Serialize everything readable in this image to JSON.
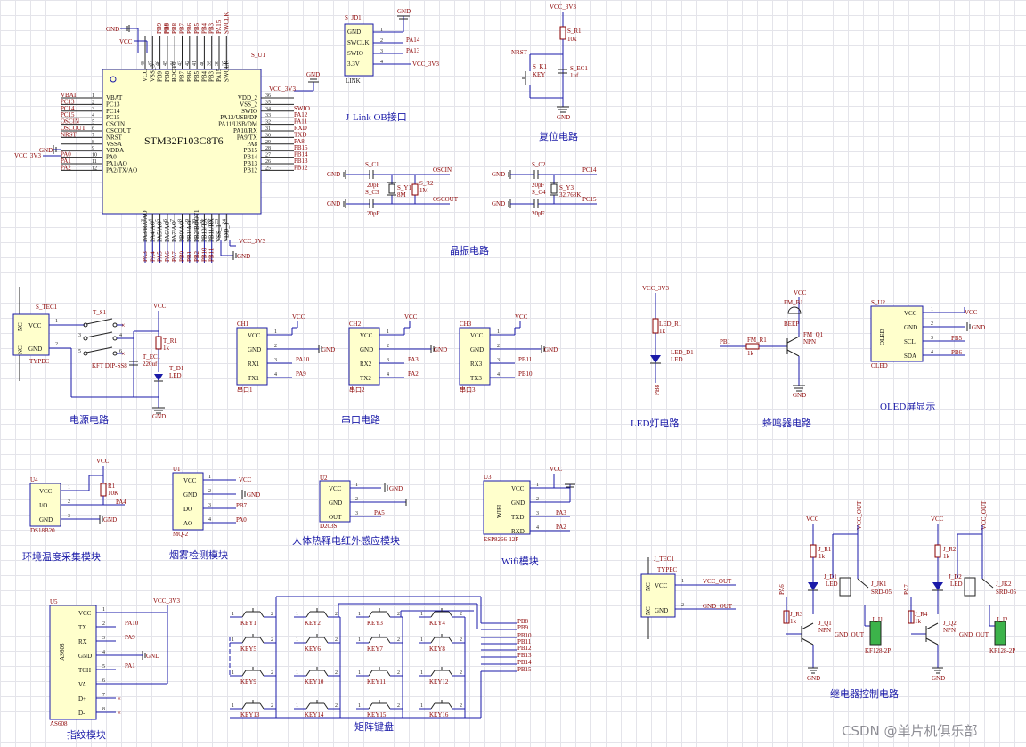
{
  "titles": {
    "jlink": "J-Link OB接口",
    "reset": "复位电路",
    "crystal": "晶振电路",
    "power": "电源电路",
    "serial": "串口电路",
    "led": "LED灯电路",
    "buzzer": "蜂鸣器电路",
    "oled": "OLED屏显示",
    "temp": "环境温度采集模块",
    "smoke": "烟雾检测模块",
    "pir": "人体热释电红外感应模块",
    "wifi": "Wifi模块",
    "finger": "指纹模块",
    "keypad": "矩阵键盘",
    "relay": "继电器控制电路"
  },
  "mcu": {
    "ref": "S_U1",
    "part": "STM32F103C8T6",
    "left_pins": [
      "VBAT",
      "PC13",
      "PC14",
      "PC15",
      "OSCIN",
      "OSCOUT",
      "NRST",
      "VSSA",
      "VDDA",
      "PA0",
      "PA1/AO",
      "PA2/TX/AO"
    ],
    "left_nums": [
      "1",
      "2",
      "3",
      "4",
      "5",
      "6",
      "7",
      "8",
      "9",
      "10",
      "11",
      "12"
    ],
    "left_nets": [
      "VBAT",
      "PC13",
      "PC14",
      "PC15",
      "OSCIN",
      "OSCOUT",
      "NRST",
      "GND",
      "VCC_3V3",
      "PA0",
      "PA1",
      "PA2"
    ],
    "right_pins": [
      "VDD_2",
      "VSS_2",
      "SWIO",
      "PA12/USB/DP",
      "PA11/USB/DM",
      "PA10/RX",
      "PA9/TX",
      "PA8",
      "PB15",
      "PB14",
      "PB13",
      "PB12"
    ],
    "right_nums": [
      "36",
      "35",
      "34",
      "33",
      "32",
      "31",
      "30",
      "29",
      "28",
      "27",
      "26",
      "25"
    ],
    "right_nets": [
      "VCC_3V3",
      "GND",
      "SWIO",
      "PA12",
      "PA11",
      "RXD",
      "TXD",
      "PA8",
      "PB15",
      "PB14",
      "PB13",
      "PB12"
    ],
    "top_pins": [
      "VCC",
      "VSS_3",
      "PB9",
      "PB8",
      "BOOT0",
      "PB7",
      "PB6",
      "PB5",
      "PB4",
      "PB3",
      "PA15",
      "SWCLK"
    ],
    "top_nums": [
      "48",
      "47",
      "46",
      "45",
      "44",
      "43",
      "42",
      "41",
      "40",
      "39",
      "38",
      "37"
    ],
    "bottom_pins": [
      "PA3/RX/AO",
      "PA4/AO",
      "PA5/AO",
      "PA6/AO",
      "PA7/AO",
      "PB0/AO",
      "PB1/AO",
      "PB2/BOOT1",
      "PB10/TX",
      "PB11/RX",
      "VSS_1",
      "VDD_1"
    ],
    "bottom_nums": [
      "13",
      "14",
      "15",
      "16",
      "17",
      "18",
      "19",
      "20",
      "21",
      "22",
      "23",
      "24"
    ],
    "top_nets": [
      "PB9",
      "PB8",
      "PB7",
      "PB6",
      "PB5",
      "PB4",
      "PB3",
      "PA15",
      "SWCLK"
    ],
    "bottom_nets": [
      "PA3",
      "PA4",
      "PA5",
      "PA6",
      "PA7",
      "PB0",
      "PB1",
      "PB2",
      "PB10",
      "PB11"
    ],
    "gnd": "GND",
    "vcc": "VCC",
    "vcc33": "VCC_3V3"
  },
  "jlink": {
    "ref": "S_JD1",
    "name": "LINK",
    "pins": [
      "GND",
      "SWCLK",
      "SWIO",
      "3.3V"
    ],
    "nums": [
      "1",
      "2",
      "3",
      "4"
    ],
    "nets": [
      "GND",
      "PA14",
      "PA13",
      "VCC_3V3"
    ]
  },
  "reset": {
    "vcc": "VCC_3V3",
    "r": "S_R1",
    "rv": "10k",
    "nrst": "NRST",
    "k": "S_K1",
    "kv": "KEY",
    "c": "S_EC1",
    "cv": "1uf",
    "gnd": "GND"
  },
  "crystal": {
    "c1": "S_C1",
    "c2": "S_C2",
    "c3": "S_C3",
    "c4": "S_C4",
    "cv": "20pF",
    "y1": "S_Y1",
    "y1v": "8M",
    "r2": "S_R2",
    "r2v": "1M",
    "y3": "S_Y3",
    "y3v": "32.768K",
    "oscin": "OSCIN",
    "oscout": "OSCOUT",
    "pc14": "PC14",
    "pc15": "PC15",
    "gnd": "GND"
  },
  "power": {
    "ref": "S_TEC1",
    "vcc": "VCC",
    "gnd": "GND",
    "nc": "NC",
    "typec": "TYPEC",
    "sw": "T_S1",
    "swp": "KFT DIP-SS8",
    "r": "T_R1",
    "rv": "1k",
    "c": "T_EC1",
    "cv": "220uf",
    "d": "T_D1",
    "dv": "LED",
    "n1": "1",
    "n2": "2",
    "n3": "3",
    "n4": "4",
    "n5": "5",
    "n6": "6"
  },
  "serial": [
    {
      "ref": "CH1",
      "name": "串口1",
      "pins": [
        "VCC",
        "GND",
        "RX1",
        "TX1"
      ],
      "nets": [
        "PA10",
        "PA9"
      ]
    },
    {
      "ref": "CH2",
      "name": "串口2",
      "pins": [
        "VCC",
        "GND",
        "RX2",
        "TX2"
      ],
      "nets": [
        "PA3",
        "PA2"
      ]
    },
    {
      "ref": "CH3",
      "name": "串口3",
      "pins": [
        "VCC",
        "GND",
        "RX3",
        "TX3"
      ],
      "nets": [
        "PB11",
        "PB10"
      ]
    }
  ],
  "led": {
    "vcc": "VCC_3V3",
    "r": "LED_R1",
    "rv": "1k",
    "d": "LED_D1",
    "dv": "LED",
    "net": "PB8"
  },
  "buzzer": {
    "b": "FM_B1",
    "bv": "BEEP",
    "r": "FM_R1",
    "rv": "1k",
    "q": "FM_Q1",
    "qv": "NPN",
    "net": "PB1",
    "vcc": "VCC",
    "gnd": "GND"
  },
  "oled": {
    "ref": "S_U2",
    "name": "OLED",
    "pins": [
      "VCC",
      "GND",
      "SCL",
      "SDA"
    ],
    "nets": [
      "VCC",
      "GND",
      "PB5",
      "PB6"
    ],
    "body": "OLED"
  },
  "temp": {
    "ref": "U4",
    "name": "DS18B20",
    "pins": [
      "VCC",
      "I/O",
      "GND"
    ],
    "r": "R1",
    "rv": "10K",
    "net": "PA4",
    "vcc": "VCC",
    "gnd": "GND"
  },
  "smoke": {
    "ref": "U1",
    "name": "MQ-2",
    "pins": [
      "VCC",
      "GND",
      "DO",
      "AO"
    ],
    "nets": [
      "VCC",
      "GND",
      "PB7",
      "PA0"
    ]
  },
  "pir": {
    "ref": "U2",
    "name": "D203S",
    "pins": [
      "VCC",
      "GND",
      "OUT"
    ],
    "net": "PA5",
    "gnd": "GND",
    "vcc": "VCC"
  },
  "wifi": {
    "ref": "U3",
    "name": "ESP8266-12F",
    "body": "WIFI",
    "pins": [
      "VCC",
      "GND",
      "TXD",
      "RXD"
    ],
    "nets": [
      "PA3",
      "PA2"
    ],
    "vcc": "VCC"
  },
  "finger": {
    "ref": "U5",
    "name": "AS608",
    "body": "AS608",
    "pins": [
      "VCC",
      "TX",
      "RX",
      "GND",
      "TCH",
      "VA",
      "D+",
      "D-"
    ],
    "nets": [
      "PA10",
      "PA9",
      "GND",
      "PA1"
    ],
    "vcc": "VCC_3V3"
  },
  "keypad": {
    "keys": [
      "KEY1",
      "KEY2",
      "KEY3",
      "KEY4",
      "KEY5",
      "KEY6",
      "KEY7",
      "KEY8",
      "KEY9",
      "KEY10",
      "KEY11",
      "KEY12",
      "KEY13",
      "KEY14",
      "KEY15",
      "KEY16"
    ],
    "nets": [
      "PB8",
      "PB9",
      "PB10",
      "PB11",
      "PB12",
      "PB13",
      "PB14",
      "PB15"
    ]
  },
  "out": {
    "ref": "J_TEC1",
    "typec": "TYPEC",
    "vcc": "VCC_OUT",
    "gnd": "GND_OUT",
    "nc": "NC"
  },
  "relays": [
    {
      "vcc": "VCC",
      "r1": "J_R1",
      "rv": "1k",
      "d": "J_D1",
      "dv": "LED",
      "r3": "J_R3",
      "q": "J_Q1",
      "qv": "NPN",
      "k": "J_JK1",
      "kv": "SRD-05",
      "j": "J_J1",
      "jv": "KF128-2P",
      "net": "PA6",
      "gnd": "GND",
      "vout": "VCC_OUT",
      "gout": "GND_OUT"
    },
    {
      "vcc": "VCC",
      "r1": "J_R2",
      "rv": "1k",
      "d": "J_D2",
      "dv": "LED",
      "r3": "J_R4",
      "q": "J_Q2",
      "qv": "NPN",
      "k": "J_JK2",
      "kv": "SRD-05",
      "j": "J_J2",
      "jv": "KF128-2P",
      "net": "PA7",
      "gnd": "GND",
      "vout": "VCC_OUT",
      "gout": "GND_OUT"
    }
  ],
  "watermark": "CSDN @单片机俱乐部",
  "colors": {
    "wire": "#1a1aa8",
    "label": "#8b0000",
    "body": "#ffffcc",
    "grid": "#e4e4ea"
  }
}
